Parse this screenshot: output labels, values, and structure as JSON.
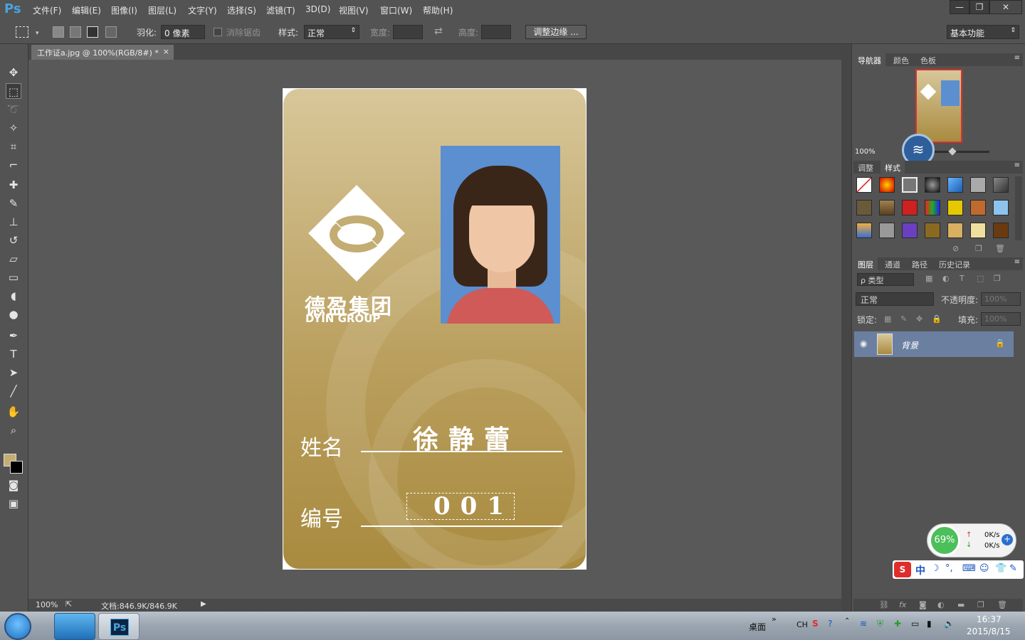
{
  "app": {
    "logo": "Ps"
  },
  "menu": [
    "文件(F)",
    "编辑(E)",
    "图像(I)",
    "图层(L)",
    "文字(Y)",
    "选择(S)",
    "滤镜(T)",
    "3D(D)",
    "视图(V)",
    "窗口(W)",
    "帮助(H)"
  ],
  "window_controls": {
    "minimize": "—",
    "restore": "❐",
    "close": "✕"
  },
  "options": {
    "feather_label": "羽化:",
    "feather_value": "0 像素",
    "antialias_label": "消除锯齿",
    "style_label": "样式:",
    "style_value": "正常",
    "width_label": "宽度:",
    "height_label": "高度:",
    "refine_button": "调整边缘 ...",
    "workspace": "基本功能"
  },
  "document": {
    "tab_title": "工作证a.jpg @ 100%(RGB/8#) *",
    "tab_close": "×",
    "zoom": "100%",
    "doc_size": "文档:846.9K/846.9K"
  },
  "card": {
    "company_cn": "德盈集团",
    "company_en": "DYIN GROUP",
    "name_label": "姓名",
    "name_value": "徐静蕾",
    "id_label": "编号",
    "id_value": "001"
  },
  "panels": {
    "navigator_tabs": [
      "导航器",
      "颜色",
      "色板"
    ],
    "navigator_zoom": "100%",
    "style_tabs": [
      "调整",
      "样式"
    ],
    "layers_tabs": [
      "图层",
      "通道",
      "路径",
      "历史记录"
    ],
    "kind_filter": "ρ 类型",
    "blend_mode": "正常",
    "opacity_label": "不透明度:",
    "opacity_value": "100%",
    "lock_label": "锁定:",
    "fill_label": "填充:",
    "fill_value": "100%",
    "layer_name": "背景"
  },
  "net_widget": {
    "percent": "69%",
    "up": "0K/s",
    "down": "0K/s"
  },
  "ime": {
    "lang": "中"
  },
  "taskbar": {
    "desktop_label": "桌面",
    "lang": "CH",
    "time": "16:37",
    "date": "2015/8/15"
  },
  "colors": {
    "card_gold": "#c3ad72",
    "photo_bg": "#5b8fd0",
    "accent_red": "#d8312a"
  }
}
